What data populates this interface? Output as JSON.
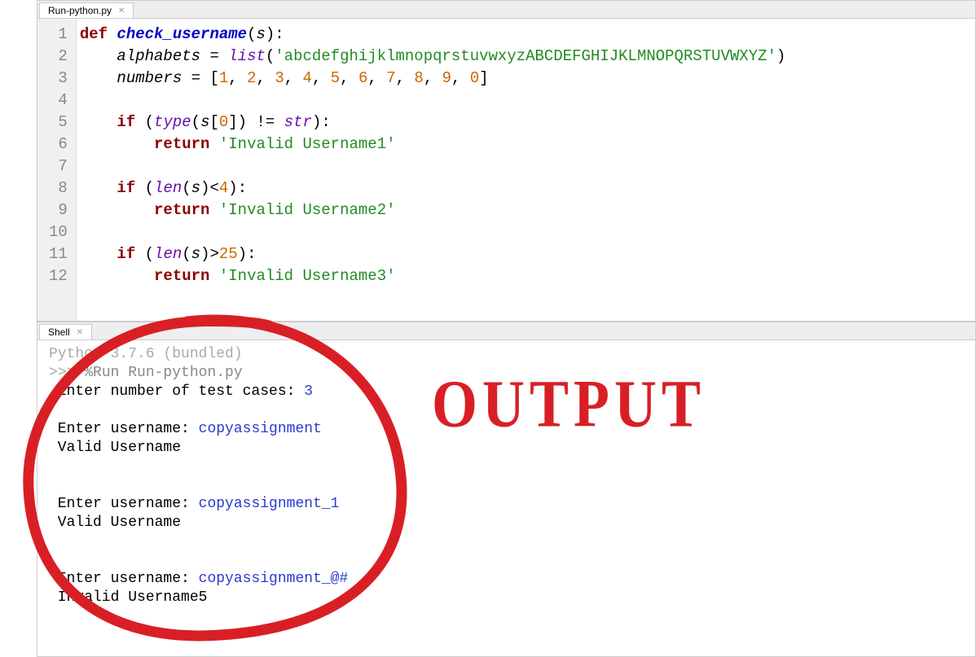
{
  "editor": {
    "tabLabel": "Run-python.py",
    "lines": [
      {
        "n": 1,
        "segments": [
          {
            "t": "def ",
            "c": "kw"
          },
          {
            "t": "check_username",
            "c": "fn"
          },
          {
            "t": "(",
            "c": ""
          },
          {
            "t": "s",
            "c": "id"
          },
          {
            "t": "):",
            "c": ""
          }
        ]
      },
      {
        "n": 2,
        "segments": [
          {
            "t": "    ",
            "c": ""
          },
          {
            "t": "alphabets",
            "c": "id"
          },
          {
            "t": " ",
            "c": ""
          },
          {
            "t": "=",
            "c": ""
          },
          {
            "t": " ",
            "c": ""
          },
          {
            "t": "list",
            "c": "bi"
          },
          {
            "t": "(",
            "c": ""
          },
          {
            "t": "'abcdefghijklmnopqrstuvwxyzABCDEFGHIJKLMNOPQRSTUVWXYZ'",
            "c": "str"
          },
          {
            "t": ")",
            "c": ""
          }
        ]
      },
      {
        "n": 3,
        "segments": [
          {
            "t": "    ",
            "c": ""
          },
          {
            "t": "numbers",
            "c": "id"
          },
          {
            "t": " ",
            "c": ""
          },
          {
            "t": "=",
            "c": ""
          },
          {
            "t": " [",
            "c": ""
          },
          {
            "t": "1",
            "c": "num"
          },
          {
            "t": ", ",
            "c": ""
          },
          {
            "t": "2",
            "c": "num"
          },
          {
            "t": ", ",
            "c": ""
          },
          {
            "t": "3",
            "c": "num"
          },
          {
            "t": ", ",
            "c": ""
          },
          {
            "t": "4",
            "c": "num"
          },
          {
            "t": ", ",
            "c": ""
          },
          {
            "t": "5",
            "c": "num"
          },
          {
            "t": ", ",
            "c": ""
          },
          {
            "t": "6",
            "c": "num"
          },
          {
            "t": ", ",
            "c": ""
          },
          {
            "t": "7",
            "c": "num"
          },
          {
            "t": ", ",
            "c": ""
          },
          {
            "t": "8",
            "c": "num"
          },
          {
            "t": ", ",
            "c": ""
          },
          {
            "t": "9",
            "c": "num"
          },
          {
            "t": ", ",
            "c": ""
          },
          {
            "t": "0",
            "c": "num"
          },
          {
            "t": "]",
            "c": ""
          }
        ]
      },
      {
        "n": 4,
        "segments": []
      },
      {
        "n": 5,
        "segments": [
          {
            "t": "    ",
            "c": ""
          },
          {
            "t": "if",
            "c": "kw"
          },
          {
            "t": " (",
            "c": ""
          },
          {
            "t": "type",
            "c": "bi"
          },
          {
            "t": "(",
            "c": ""
          },
          {
            "t": "s",
            "c": "id"
          },
          {
            "t": "[",
            "c": ""
          },
          {
            "t": "0",
            "c": "num"
          },
          {
            "t": "]) ",
            "c": ""
          },
          {
            "t": "!=",
            "c": ""
          },
          {
            "t": " ",
            "c": ""
          },
          {
            "t": "str",
            "c": "bi"
          },
          {
            "t": "):",
            "c": ""
          }
        ]
      },
      {
        "n": 6,
        "segments": [
          {
            "t": "        ",
            "c": ""
          },
          {
            "t": "return",
            "c": "kw"
          },
          {
            "t": " ",
            "c": ""
          },
          {
            "t": "'Invalid Username1'",
            "c": "str"
          }
        ]
      },
      {
        "n": 7,
        "segments": []
      },
      {
        "n": 8,
        "segments": [
          {
            "t": "    ",
            "c": ""
          },
          {
            "t": "if",
            "c": "kw"
          },
          {
            "t": " (",
            "c": ""
          },
          {
            "t": "len",
            "c": "bi"
          },
          {
            "t": "(",
            "c": ""
          },
          {
            "t": "s",
            "c": "id"
          },
          {
            "t": ")",
            "c": ""
          },
          {
            "t": "<",
            "c": ""
          },
          {
            "t": "4",
            "c": "num"
          },
          {
            "t": "):",
            "c": ""
          }
        ]
      },
      {
        "n": 9,
        "segments": [
          {
            "t": "        ",
            "c": ""
          },
          {
            "t": "return",
            "c": "kw"
          },
          {
            "t": " ",
            "c": ""
          },
          {
            "t": "'Invalid Username2'",
            "c": "str"
          }
        ]
      },
      {
        "n": 10,
        "segments": []
      },
      {
        "n": 11,
        "segments": [
          {
            "t": "    ",
            "c": ""
          },
          {
            "t": "if",
            "c": "kw"
          },
          {
            "t": " (",
            "c": ""
          },
          {
            "t": "len",
            "c": "bi"
          },
          {
            "t": "(",
            "c": ""
          },
          {
            "t": "s",
            "c": "id"
          },
          {
            "t": ")",
            "c": ""
          },
          {
            "t": ">",
            "c": ""
          },
          {
            "t": "25",
            "c": "num"
          },
          {
            "t": "):",
            "c": ""
          }
        ]
      },
      {
        "n": 12,
        "segments": [
          {
            "t": "        ",
            "c": ""
          },
          {
            "t": "return",
            "c": "kw"
          },
          {
            "t": " ",
            "c": ""
          },
          {
            "t": "'Invalid Username3'",
            "c": "str"
          }
        ]
      }
    ]
  },
  "shell": {
    "tabLabel": "Shell",
    "banner": "Python 3.7.6 (bundled)",
    "prompt": ">>> ",
    "cmd": "%Run Run-python.py",
    "lines": [
      [
        {
          "t": " Enter number of test cases: ",
          "c": ""
        },
        {
          "t": "3",
          "c": "sh-input"
        }
      ],
      [],
      [
        {
          "t": " Enter username: ",
          "c": ""
        },
        {
          "t": "copyassignment",
          "c": "sh-input"
        }
      ],
      [
        {
          "t": " Valid Username",
          "c": ""
        }
      ],
      [],
      [],
      [
        {
          "t": " Enter username: ",
          "c": ""
        },
        {
          "t": "copyassignment_1",
          "c": "sh-input"
        }
      ],
      [
        {
          "t": " Valid Username",
          "c": ""
        }
      ],
      [],
      [],
      [
        {
          "t": " Enter username: ",
          "c": ""
        },
        {
          "t": "copyassignment_@#",
          "c": "sh-input"
        }
      ],
      [
        {
          "t": " Invalid Username5",
          "c": ""
        }
      ]
    ]
  },
  "annotation": {
    "label": "OUTPUT",
    "color": "#d81f26"
  }
}
